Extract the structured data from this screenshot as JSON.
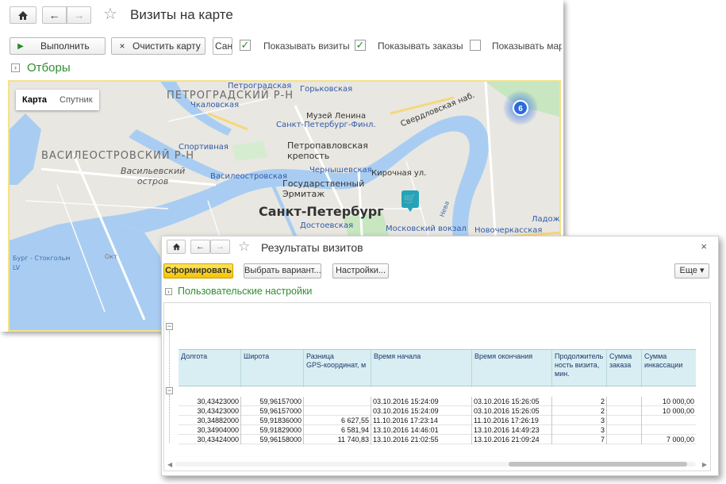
{
  "window1": {
    "title": "Визиты на карте",
    "nav": {
      "home_icon": "home-icon",
      "back_icon": "arrow-left-icon",
      "forward_icon": "arrow-right-icon",
      "favorite_icon": "star-icon"
    },
    "toolbar": {
      "run_label": "Выполнить",
      "clear_label": "Очистить карту",
      "input_value": "Сан",
      "show_visits_label": "Показывать визиты",
      "show_visits_checked": true,
      "show_orders_label": "Показывать заказы",
      "show_orders_checked": true,
      "show_routes_label": "Показывать марш",
      "show_routes_checked": false
    },
    "filters_label": "Отборы",
    "map": {
      "type_map": "Карта",
      "type_satellite": "Спутник",
      "cluster_count": "6",
      "labels": {
        "petrogradsky": "ПЕТРОГРАДСКИЙ Р-Н",
        "vasileostrovsky": "ВАСИЛЕОСТРОВСКИЙ Р-Н",
        "vasilevsky_island": "Васильевский\nостров",
        "spb": "Санкт-Петербург",
        "chkalovskaya": "Чкаловская",
        "gorkovskaya": "Горьковская",
        "petrogradskaya": "Петроградская",
        "lenin_museum": "Музей Ленина",
        "finland_station": "Санкт-Петербург-Финл.",
        "sportivnaya": "Спортивная",
        "peter_paul": "Петропавловская\nкрепость",
        "vasileostrovskaya": "Василеостровская",
        "chernyshevskaya": "Чернышевская",
        "kirochnaya": "Кирочная ул.",
        "hermitage": "Государственный\nЭрмитаж",
        "dostoevskaya": "Достоевская",
        "moscow_station": "Московский вокзал",
        "novocherkasskaya": "Новочеркасская",
        "ladozhsky": "Ладожск",
        "sverdlovskaya": "Свердловская наб.",
        "baltic": "Бург - Стокгольм",
        "dock": "Окт",
        "lv": "LV",
        "neva": "Нева"
      }
    }
  },
  "window2": {
    "title": "Результаты визитов",
    "close_icon": "close-icon",
    "generate_label": "Сформировать",
    "select_variant_label": "Выбрать вариант...",
    "settings_label": "Настройки...",
    "more_label": "Еще ▾",
    "user_settings_label": "Пользовательские настройки",
    "table": {
      "headers": [
        "Долгота",
        "Широта",
        "Разница\nGPS-координат, м",
        "Время начала",
        "Время окончания",
        "Продолжитель\nность визита,\nмин.",
        "Сумма\nзаказа",
        "Сумма\nинкассации"
      ],
      "rows": [
        [
          "30,43423000",
          "59,96157000",
          "",
          "03.10.2016 15:24:09",
          "03.10.2016 15:26:05",
          "2",
          "",
          "10 000,00"
        ],
        [
          "30,43423000",
          "59,96157000",
          "",
          "03.10.2016 15:24:09",
          "03.10.2016 15:26:05",
          "2",
          "",
          "10 000,00"
        ],
        [
          "30,34882000",
          "59,91836000",
          "6 627,55",
          "11.10.2016 17:23:14",
          "11.10.2016 17:26:19",
          "3",
          "",
          ""
        ],
        [
          "30,34904000",
          "59,91829000",
          "6 581,94",
          "13.10.2016 14:46:01",
          "13.10.2016 14:49:23",
          "3",
          "",
          ""
        ],
        [
          "30,43424000",
          "59,96158000",
          "11 740,83",
          "13.10.2016 21:02:55",
          "13.10.2016 21:09:24",
          "7",
          "",
          "7 000,00"
        ]
      ]
    }
  }
}
